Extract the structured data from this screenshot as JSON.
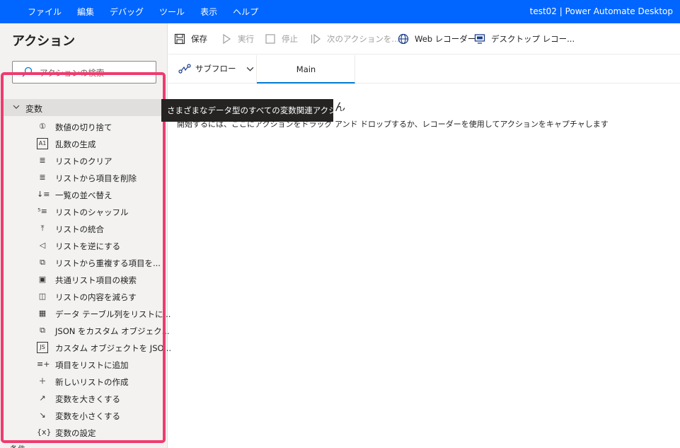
{
  "menu": [
    "ファイル",
    "編集",
    "デバッグ",
    "ツール",
    "表示",
    "ヘルプ"
  ],
  "window_title": "test02 | Power Automate Desktop",
  "sidebar": {
    "title": "アクション",
    "search_placeholder": "アクションの検索",
    "group": "変数",
    "items": [
      {
        "label": "数値の切り捨て",
        "icon": "①"
      },
      {
        "label": "乱数の生成",
        "icon": "A1"
      },
      {
        "label": "リストのクリア",
        "icon": "≣"
      },
      {
        "label": "リストから項目を削除",
        "icon": "≣"
      },
      {
        "label": "一覧の並べ替え",
        "icon": "↓≡"
      },
      {
        "label": "リストのシャッフル",
        "icon": "⁵≡"
      },
      {
        "label": "リストの統合",
        "icon": "⤒"
      },
      {
        "label": "リストを逆にする",
        "icon": "◁"
      },
      {
        "label": "リストから重複する項目を...",
        "icon": "⧉"
      },
      {
        "label": "共通リスト項目の検索",
        "icon": "▣"
      },
      {
        "label": "リストの内容を減らす",
        "icon": "◫"
      },
      {
        "label": "データ テーブル列をリストに...",
        "icon": "▦"
      },
      {
        "label": "JSON をカスタム オブジェク...",
        "icon": "⧉"
      },
      {
        "label": "カスタム オブジェクトを JSO...",
        "icon": "JS"
      },
      {
        "label": "項目をリストに追加",
        "icon": "≡+"
      },
      {
        "label": "新しいリストの作成",
        "icon": "＋"
      },
      {
        "label": "変数を大きくする",
        "icon": "↗"
      },
      {
        "label": "変数を小さくする",
        "icon": "↘"
      },
      {
        "label": "変数の設定",
        "icon": "{x}"
      }
    ],
    "next_group": "条件"
  },
  "toolbar": {
    "save": "保存",
    "run": "実行",
    "stop": "停止",
    "next": "次のアクションを...",
    "web_recorder": "Web レコーダー",
    "desktop_recorder": "デスクトップ レコー..."
  },
  "tabs": {
    "subflow": "サブフロー",
    "main": "Main"
  },
  "canvas": {
    "title_visible": "ん",
    "subtitle": "開始するには、ここにアクションをドラッグ アンド ドロップするか、レコーダーを使用してアクションをキャプチャします"
  },
  "tooltip": "さまざまなデータ型のすべての変数関連アクション",
  "colors": {
    "titlebar": "#0066ff",
    "highlight": "#ef3b6e",
    "accent": "#0078d4"
  }
}
